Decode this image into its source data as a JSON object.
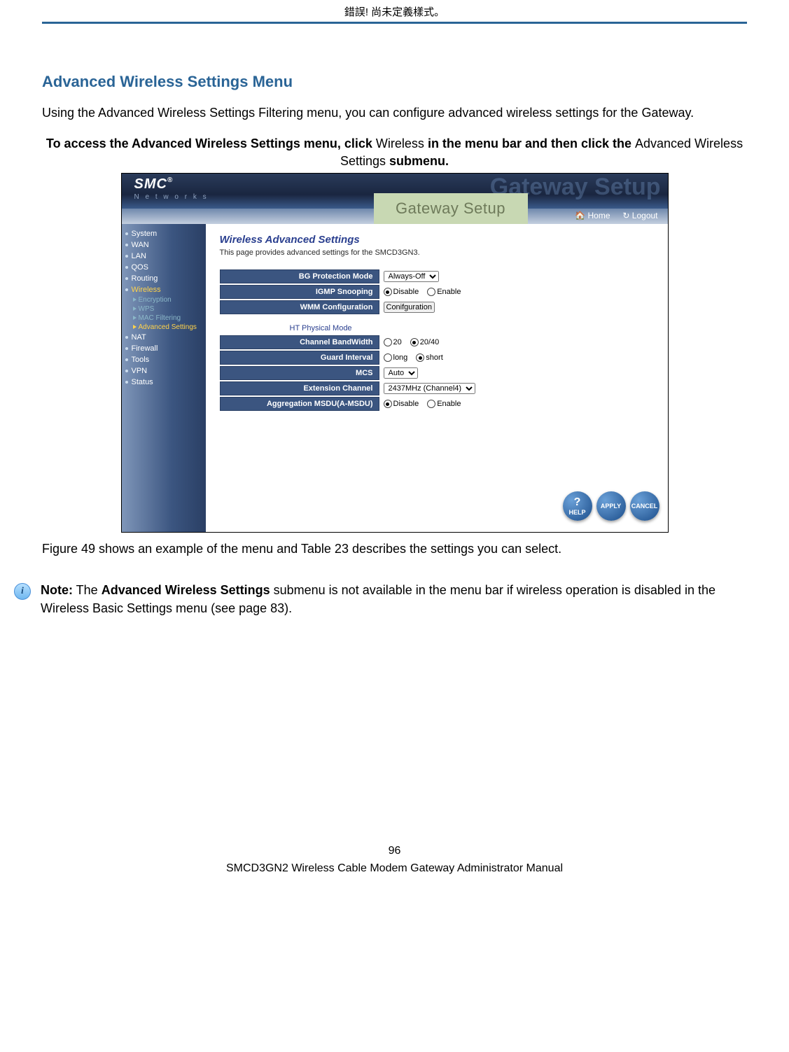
{
  "header_error": "錯誤! 尚未定義樣式。",
  "section_title": "Advanced Wireless Settings Menu",
  "intro": "Using the Advanced Wireless Settings Filtering menu, you can configure advanced wireless settings for the Gateway.",
  "access": {
    "p1a": "To access the Advanced Wireless Settings menu, click ",
    "p1b": "Wireless",
    "p1c": " in the menu bar and then click the ",
    "p1d": "Advanced Wireless Settings",
    "p1e": " submenu."
  },
  "shot": {
    "logo": "SMC",
    "logo_reg": "®",
    "logo_sub": "N e t w o r k s",
    "ghost": "Gateway Setup",
    "banner": "Gateway Setup",
    "home": "Home",
    "logout": "Logout",
    "sidebar": {
      "items": [
        "System",
        "WAN",
        "LAN",
        "QOS",
        "Routing",
        "Wireless",
        "NAT",
        "Firewall",
        "Tools",
        "VPN",
        "Status"
      ],
      "sub": [
        "Encryption",
        "WPS",
        "MAC Filtering",
        "Advanced Settings"
      ]
    },
    "main": {
      "title": "Wireless Advanced Settings",
      "sub": "This page provides advanced settings for the SMCD3GN3.",
      "rows1": {
        "bg_label": "BG Protection Mode",
        "bg_value": "Always-Off",
        "igmp_label": "IGMP Snooping",
        "disable": "Disable",
        "enable": "Enable",
        "wmm_label": "WMM Configuration",
        "wmm_btn": "Conifguration"
      },
      "ht_title": "HT Physical Mode",
      "rows2": {
        "cbw_label": "Channel BandWidth",
        "cbw_20": "20",
        "cbw_2040": "20/40",
        "gi_label": "Guard Interval",
        "gi_long": "long",
        "gi_short": "short",
        "mcs_label": "MCS",
        "mcs_value": "Auto",
        "ext_label": "Extension Channel",
        "ext_value": "2437MHz (Channel4)",
        "amsdu_label": "Aggregation MSDU(A-MSDU)"
      },
      "buttons": {
        "help": "HELP",
        "apply": "APPLY",
        "cancel": "CANCEL"
      }
    }
  },
  "caption": "Figure 49 shows an example of the menu and Table 23 describes the settings you can select.",
  "note": {
    "a": "Note:",
    "b": " The ",
    "c": "Advanced Wireless Settings",
    "d": " submenu is not available in the menu bar if wireless operation is disabled in the Wireless Basic Settings menu (see page 83)."
  },
  "footer": {
    "page": "96",
    "title": "SMCD3GN2 Wireless Cable Modem Gateway Administrator Manual"
  }
}
